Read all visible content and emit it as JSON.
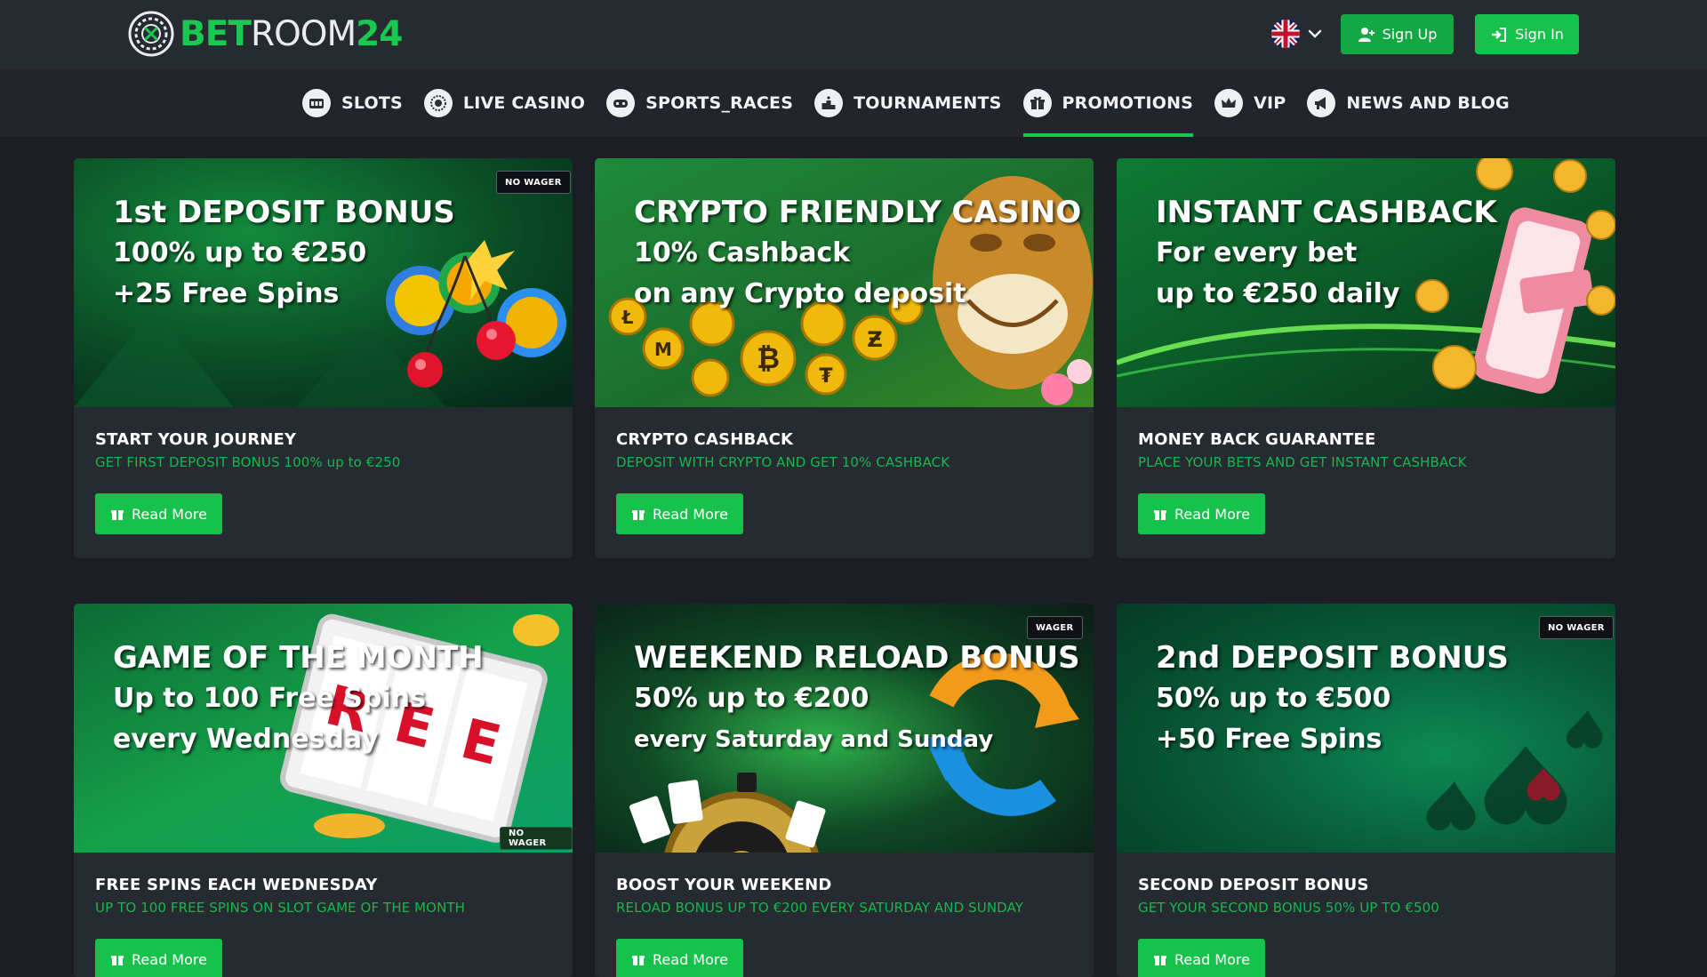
{
  "header": {
    "logo": {
      "part1": "BET",
      "part2": "ROOM",
      "part3": "24"
    },
    "language": "EN",
    "signup_label": "Sign Up",
    "signin_label": "Sign In"
  },
  "nav": [
    {
      "label": "SLOTS",
      "icon": "slot-machine-icon"
    },
    {
      "label": "LIVE CASINO",
      "icon": "roulette-icon"
    },
    {
      "label": "SPORTS_RACES",
      "icon": "gamepad-icon"
    },
    {
      "label": "TOURNAMENTS",
      "icon": "podium-icon"
    },
    {
      "label": "PROMOTIONS",
      "icon": "gift-icon",
      "active": true
    },
    {
      "label": "VIP",
      "icon": "crown-icon"
    },
    {
      "label": "NEWS AND BLOG",
      "icon": "megaphone-icon"
    }
  ],
  "promos": [
    {
      "banner_lines": [
        "1st DEPOSIT BONUS",
        "100% up to €250",
        "+25 Free Spins"
      ],
      "tag": "NO WAGER",
      "title": "START YOUR JOURNEY",
      "subtitle": "GET FIRST DEPOSIT BONUS 100% up to €250",
      "button": "Read More"
    },
    {
      "banner_lines": [
        "CRYPTO FRIENDLY CASINO",
        "10% Cashback",
        "on any Crypto deposit"
      ],
      "tag": "",
      "title": "CRYPTO CASHBACK",
      "subtitle": "DEPOSIT WITH CRYPTO AND GET 10% CASHBACK",
      "button": "Read More"
    },
    {
      "banner_lines": [
        "INSTANT CASHBACK",
        "For every bet",
        "up to €250 daily"
      ],
      "tag": "",
      "title": "MONEY BACK GUARANTEE",
      "subtitle": "PLACE YOUR BETS AND GET INSTANT CASHBACK",
      "button": "Read More"
    },
    {
      "banner_lines": [
        "GAME OF THE MONTH",
        "Up to 100 Free Spins",
        "every Wednesday"
      ],
      "tag": "NO WAGER",
      "title": "FREE SPINS EACH WEDNESDAY",
      "subtitle": "UP TO 100 FREE SPINS ON SLOT GAME OF THE MONTH",
      "button": "Read More"
    },
    {
      "banner_lines": [
        "WEEKEND RELOAD BONUS",
        "50% up to €200",
        "every Saturday and Sunday"
      ],
      "tag": "WAGER",
      "title": "BOOST YOUR WEEKEND",
      "subtitle": "RELOAD BONUS UP TO €200 EVERY SATURDAY AND SUNDAY",
      "button": "Read More"
    },
    {
      "banner_lines": [
        "2nd DEPOSIT BONUS",
        "50% up to €500",
        "+50 Free Spins"
      ],
      "tag": "NO WAGER",
      "title": "SECOND DEPOSIT BONUS",
      "subtitle": "GET YOUR SECOND BONUS 50% UP TO €500",
      "button": "Read More"
    }
  ],
  "colors": {
    "accent": "#16c14c",
    "background": "#1b1e24",
    "card": "#262a31"
  }
}
